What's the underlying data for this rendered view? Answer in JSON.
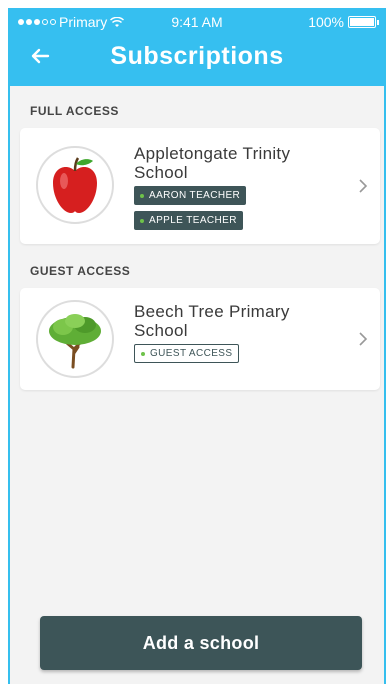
{
  "status_bar": {
    "carrier": "Primary",
    "time": "9:41 AM",
    "battery": "100%"
  },
  "header": {
    "title": "Subscriptions",
    "back_icon": "arrow-left-icon"
  },
  "sections": [
    {
      "label": "FULL ACCESS",
      "schools": [
        {
          "name": "Appletongate Trinity School",
          "icon": "apple-icon",
          "badges": [
            "AARON TEACHER",
            "APPLE TEACHER"
          ]
        }
      ]
    },
    {
      "label": "GUEST ACCESS",
      "schools": [
        {
          "name": "Beech Tree Primary School",
          "icon": "tree-icon",
          "badges": [
            "GUEST ACCESS"
          ]
        }
      ]
    }
  ],
  "actions": {
    "add_school_label": "Add a school"
  },
  "colors": {
    "header_bg": "#36bff0",
    "button_bg": "#3d5558",
    "badge_dot": "#6ec24a"
  }
}
